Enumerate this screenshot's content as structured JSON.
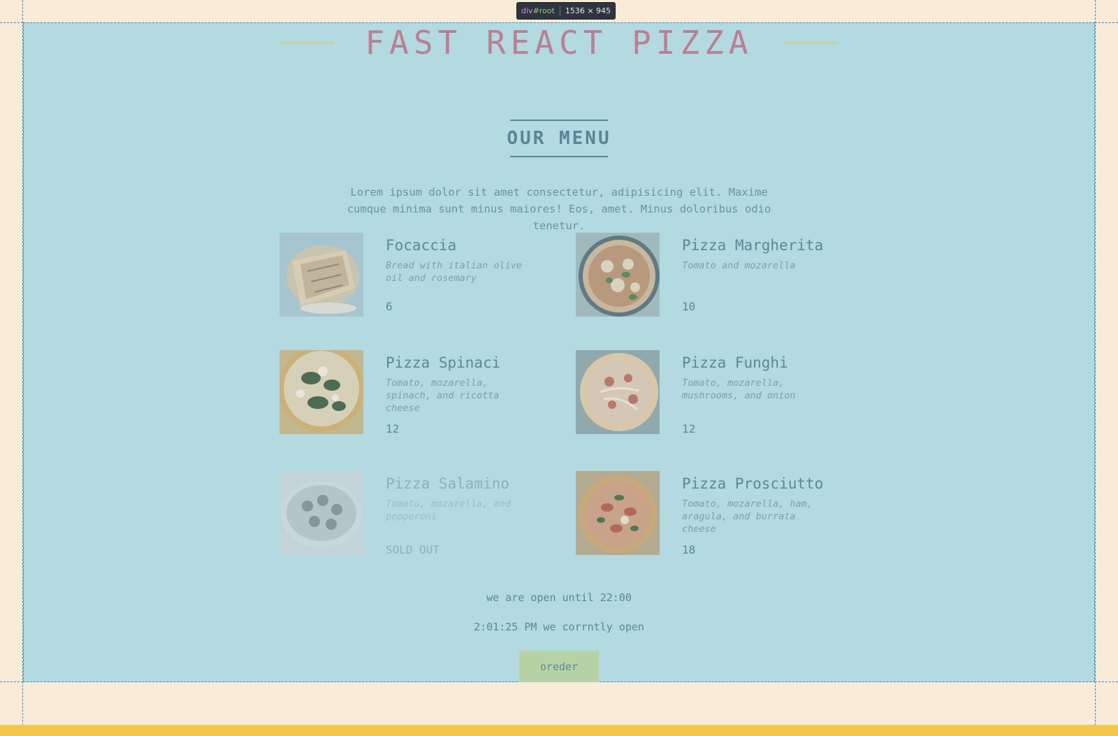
{
  "devtools": {
    "tag": "div",
    "hash": "#",
    "id": "root",
    "dimensions": "1536 × 945"
  },
  "header": {
    "title": "FAST REACT PIZZA"
  },
  "menu": {
    "heading": "OUR MENU",
    "intro": "Lorem ipsum dolor sit amet consectetur, adipisicing elit. Maxime cumque minima sunt minus maiores! Eos, amet. Minus doloribus odio tenetur.",
    "pizzas": [
      {
        "name": "Focaccia",
        "ingredients": "Bread with italian olive oil and rosemary",
        "price": "6",
        "sold_out": false,
        "image": "focaccia-photo"
      },
      {
        "name": "Pizza Margherita",
        "ingredients": "Tomato and mozarella",
        "price": "10",
        "sold_out": false,
        "image": "margherita-photo"
      },
      {
        "name": "Pizza Spinaci",
        "ingredients": "Tomato, mozarella, spinach, and ricotta cheese",
        "price": "12",
        "sold_out": false,
        "image": "spinaci-photo"
      },
      {
        "name": "Pizza Funghi",
        "ingredients": "Tomato, mozarella, mushrooms, and onion",
        "price": "12",
        "sold_out": false,
        "image": "funghi-photo"
      },
      {
        "name": "Pizza Salamino",
        "ingredients": "Tomato, mozarella, and pepperoni",
        "price": "SOLD OUT",
        "sold_out": true,
        "image": "salamino-photo"
      },
      {
        "name": "Pizza Prosciutto",
        "ingredients": "Tomato, mozarella, ham, aragula, and burrata cheese",
        "price": "18",
        "sold_out": false,
        "image": "prosciutto-photo"
      }
    ]
  },
  "footer": {
    "open_until": "we are open until 22:00",
    "current_status": "2:01:25 PM we corrntly open",
    "order_label": "oreder"
  },
  "colors": {
    "page_background": "#f8ebd8",
    "overlay_highlight": "#b3d9e1",
    "title": "#b98190",
    "accent_line": "#c3d19c",
    "order_button": "#b7d3a5",
    "bottom_bar": "#f3c84a"
  }
}
